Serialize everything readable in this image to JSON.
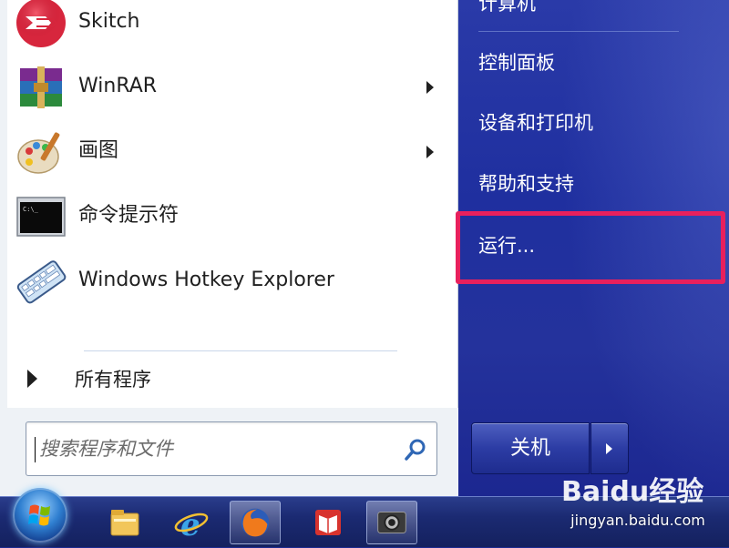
{
  "start_menu": {
    "programs": [
      {
        "label": "Skitch",
        "icon": "skitch-icon",
        "has_submenu": false
      },
      {
        "label": "WinRAR",
        "icon": "winrar-icon",
        "has_submenu": true
      },
      {
        "label": "画图",
        "icon": "paint-icon",
        "has_submenu": true
      },
      {
        "label": "命令提示符",
        "icon": "cmd-icon",
        "has_submenu": false
      },
      {
        "label": "Windows Hotkey Explorer",
        "icon": "keyboard-icon",
        "has_submenu": false
      }
    ],
    "all_programs_label": "所有程序",
    "search": {
      "placeholder": "搜索程序和文件",
      "value": ""
    },
    "right_items": [
      {
        "label": "计算机"
      },
      {
        "label": "控制面板"
      },
      {
        "label": "设备和打印机"
      },
      {
        "label": "帮助和支持"
      },
      {
        "label": "运行..."
      }
    ],
    "shutdown_label": "关机"
  },
  "taskbar": {
    "items": [
      "start-orb-icon",
      "explorer-icon",
      "ie-icon",
      "firefox-icon",
      "reader-icon",
      "camera-icon"
    ]
  },
  "watermark": {
    "text": "Baidu经验",
    "url": "jingyan.baidu.com"
  },
  "colors": {
    "highlight": "#e8205d",
    "aero_blue": "#1f2f9f"
  }
}
